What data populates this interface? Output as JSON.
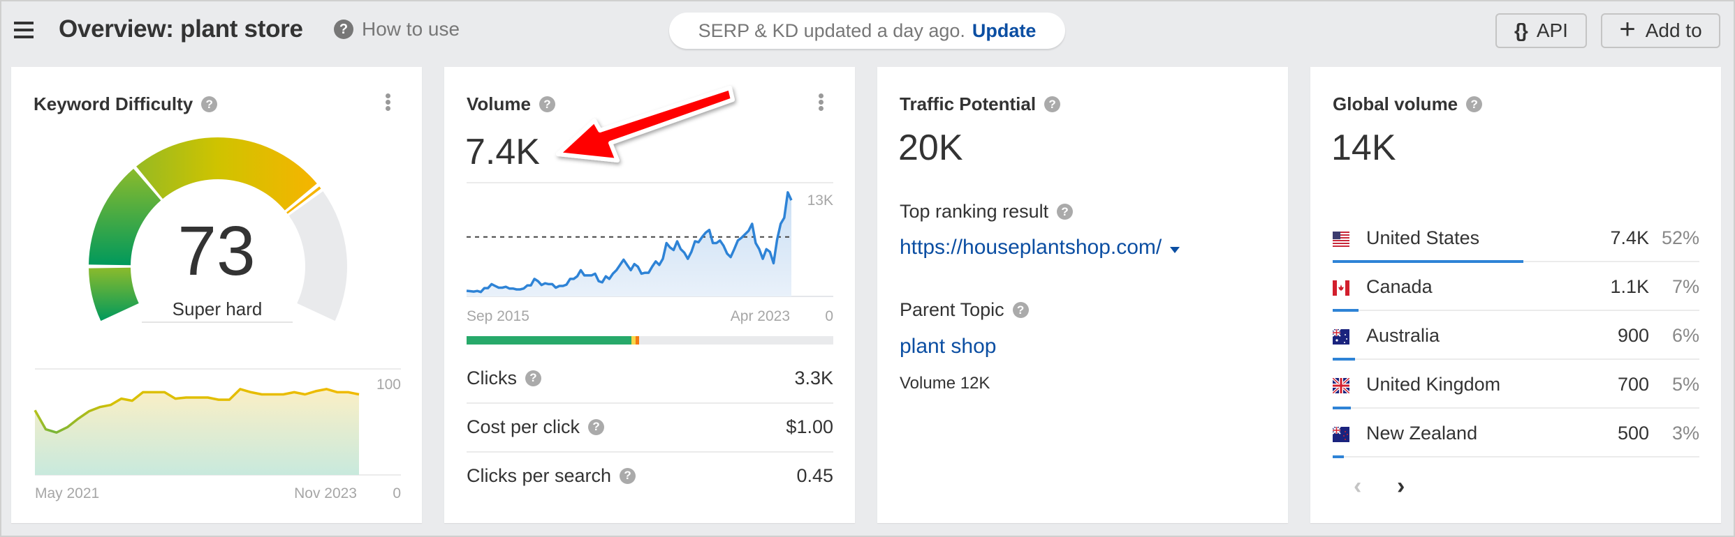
{
  "header": {
    "title": "Overview: plant store",
    "how_to_use": "How to use",
    "update_notice": "SERP & KD updated a day ago.",
    "update_link": "Update",
    "api_button": "API",
    "add_to_button": "Add to"
  },
  "colors": {
    "accent_blue": "#2e83d6",
    "link_blue": "#0b4ea2",
    "annotation_red": "#ff0000"
  },
  "keyword_difficulty": {
    "title": "Keyword Difficulty",
    "value": "73",
    "score": 73,
    "max": 100,
    "label": "Super hard",
    "chart": {
      "type": "area",
      "x_start": "May 2021",
      "x_end": "Nov 2023",
      "y_max_label": "100",
      "y_min_label": "0",
      "ylim": [
        0,
        100
      ],
      "values": [
        61,
        43,
        40,
        45,
        53,
        60,
        64,
        66,
        72,
        70,
        78,
        78,
        78,
        72,
        73,
        73,
        73,
        71,
        71,
        81,
        78,
        76,
        76,
        76,
        78,
        76,
        79,
        81,
        78,
        78,
        76
      ]
    }
  },
  "volume": {
    "title": "Volume",
    "value": "7.4K",
    "chart": {
      "type": "area",
      "x_start": "Sep 2015",
      "x_end": "Apr 2023",
      "y_max_label": "13K",
      "y_min_label": "0",
      "ylim": [
        0,
        13
      ],
      "average": 6.8,
      "values": [
        0.64,
        0.6,
        0.55,
        0.62,
        0.5,
        0.95,
        0.95,
        1.4,
        1.2,
        1.0,
        1.0,
        1.1,
        0.9,
        0.9,
        0.8,
        0.8,
        0.9,
        1.25,
        1.25,
        2.0,
        1.75,
        1.3,
        1.5,
        1.4,
        1.4,
        1.0,
        1.2,
        1.2,
        1.35,
        2.0,
        2.0,
        2.3,
        3.0,
        2.4,
        2.4,
        2.4,
        2.6,
        1.75,
        1.6,
        2.3,
        2.0,
        2.6,
        3.0,
        3.6,
        4.2,
        3.6,
        3.0,
        3.7,
        3.4,
        2.6,
        2.7,
        2.7,
        3.4,
        4.0,
        3.6,
        4.3,
        6.1,
        5.6,
        5.3,
        6.3,
        5.4,
        5.0,
        4.3,
        5.1,
        6.3,
        6.2,
        6.8,
        7.3,
        7.6,
        6.1,
        6.1,
        6.4,
        5.8,
        4.9,
        4.5,
        5.4,
        6.4,
        6.7,
        7.1,
        7.5,
        8.3,
        6.1,
        5.4,
        4.3,
        5.4,
        5.1,
        3.8,
        6.5,
        8.3,
        9.0,
        11.9,
        11.0
      ]
    },
    "clicks_distribution": {
      "organic_pct": 45,
      "paid_pct": 1,
      "other_pct": 1
    },
    "metrics": [
      {
        "label": "Clicks",
        "value": "3.3K"
      },
      {
        "label": "Cost per click",
        "value": "$1.00"
      },
      {
        "label": "Clicks per search",
        "value": "0.45"
      }
    ]
  },
  "traffic_potential": {
    "title": "Traffic Potential",
    "value": "20K",
    "top_ranking_label": "Top ranking result",
    "top_ranking_url": "https://houseplantshop.com/",
    "parent_topic_label": "Parent Topic",
    "parent_topic": "plant shop",
    "parent_volume": "Volume 12K"
  },
  "global_volume": {
    "title": "Global volume",
    "value": "14K",
    "countries": [
      {
        "name": "United States",
        "flag": "us-flag-icon",
        "volume": "7.4K",
        "percent": "52%",
        "share": 52
      },
      {
        "name": "Canada",
        "flag": "ca-flag-icon",
        "volume": "1.1K",
        "percent": "7%",
        "share": 7
      },
      {
        "name": "Australia",
        "flag": "au-flag-icon",
        "volume": "900",
        "percent": "6%",
        "share": 6
      },
      {
        "name": "United Kingdom",
        "flag": "gb-flag-icon",
        "volume": "700",
        "percent": "5%",
        "share": 5
      },
      {
        "name": "New Zealand",
        "flag": "nz-flag-icon",
        "volume": "500",
        "percent": "3%",
        "share": 3
      }
    ],
    "prev_icon": "chevron-left-icon",
    "next_icon": "chevron-right-icon"
  }
}
